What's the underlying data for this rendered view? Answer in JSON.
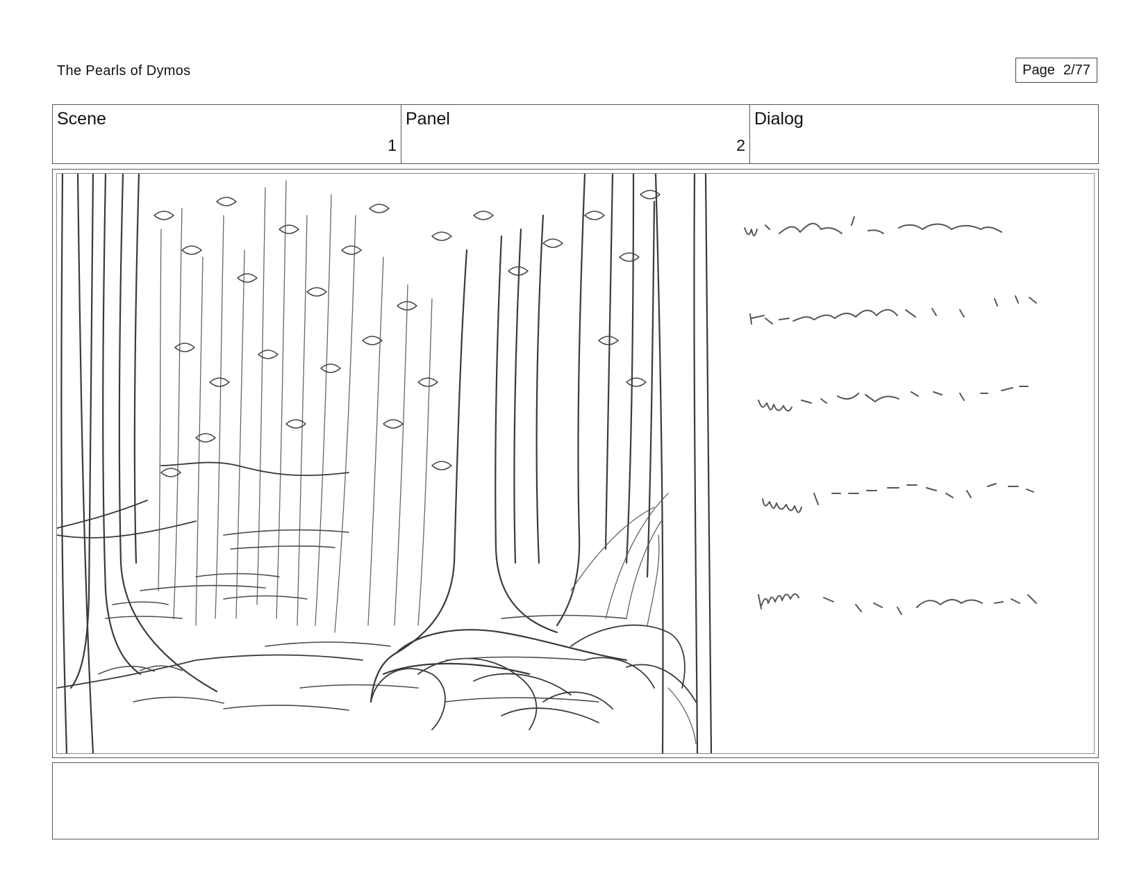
{
  "header": {
    "title": "The Pearls of Dymos",
    "page_label": "Page",
    "page_number": "2/77"
  },
  "info": {
    "scene_label": "Scene",
    "scene_value": "1",
    "panel_label": "Panel",
    "panel_value": "2",
    "dialog_label": "Dialog",
    "dialog_value": ""
  },
  "colors": {
    "line": "#555555",
    "sketch": "#3a3a3a",
    "background": "#ffffff"
  }
}
